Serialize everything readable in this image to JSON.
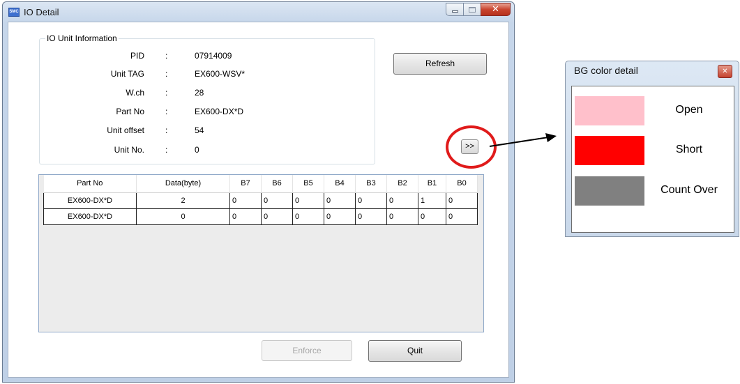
{
  "window": {
    "title": "IO Detail",
    "app_icon_text": "SMC"
  },
  "io_unit_info": {
    "legend": "IO Unit Information",
    "rows": [
      {
        "label": "PID",
        "value": "07914009"
      },
      {
        "label": "Unit TAG",
        "value": "EX600-WSV*"
      },
      {
        "label": "W.ch",
        "value": "28"
      },
      {
        "label": "Part No",
        "value": "EX600-DX*D"
      },
      {
        "label": "Unit offset",
        "value": "54"
      },
      {
        "label": "Unit No.",
        "value": "0"
      }
    ],
    "separator": ":"
  },
  "buttons": {
    "refresh": "Refresh",
    "more": ">>",
    "enforce": "Enforce",
    "quit": "Quit"
  },
  "grid": {
    "columns": [
      "Part No",
      "Data(byte)",
      "B7",
      "B6",
      "B5",
      "B4",
      "B3",
      "B2",
      "B1",
      "B0"
    ],
    "rows": [
      [
        "EX600-DX*D",
        "2",
        "0",
        "0",
        "0",
        "0",
        "0",
        "0",
        "1",
        "0"
      ],
      [
        "EX600-DX*D",
        "0",
        "0",
        "0",
        "0",
        "0",
        "0",
        "0",
        "0",
        "0"
      ]
    ]
  },
  "bg_color_popup": {
    "title": "BG color detail",
    "items": [
      {
        "label": "Open",
        "color": "#ffc0cb"
      },
      {
        "label": "Short",
        "color": "#ff0000"
      },
      {
        "label": "Count Over",
        "color": "#808080"
      }
    ]
  },
  "colors": {
    "highlight": "#e01b1b",
    "disabled_text": "#a7a7a7"
  }
}
